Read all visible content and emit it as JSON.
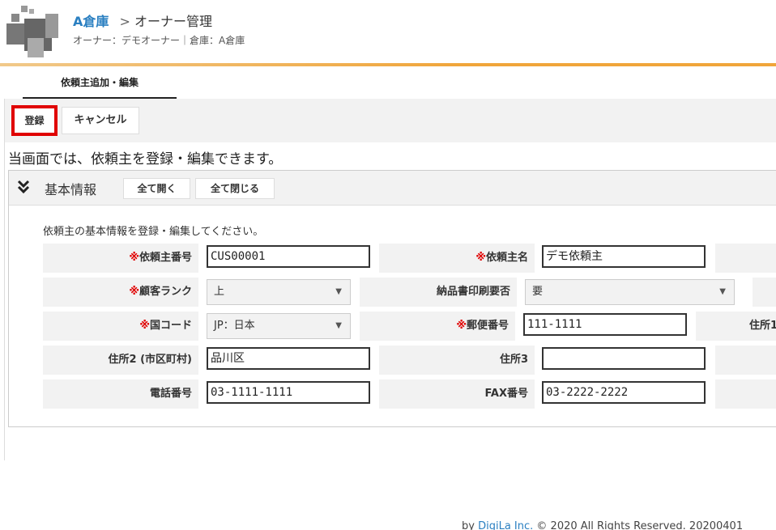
{
  "header": {
    "warehouse": "A倉庫",
    "crumb_sep": ">",
    "page": "オーナー管理",
    "subline": "オーナー：デモオーナー｜倉庫：A倉庫"
  },
  "tabs": [
    {
      "label": "依頼主追加・編集",
      "active": true
    }
  ],
  "toolbar": {
    "register_label": "登録",
    "cancel_label": "キャンセル"
  },
  "description": "当画面では、依頼主を登録・編集できます。",
  "section": {
    "title": "基本情報",
    "open_all_label": "全て開く",
    "close_all_label": "全て閉じる",
    "description": "依頼主の基本情報を登録・編集してください。"
  },
  "form": {
    "required_mark": "※",
    "client_code": {
      "label": "依頼主番号",
      "value": "CUS00001"
    },
    "client_name": {
      "label": "依頼主名",
      "value": "デモ依頼主"
    },
    "customer_rank": {
      "label": "顧客ランク",
      "value": "上"
    },
    "delivery_print": {
      "label": "納品書印刷要否",
      "value": "要"
    },
    "country_code": {
      "label": "国コード",
      "value": "JP：日本"
    },
    "postal_code": {
      "label": "郵便番号",
      "value": "111-1111"
    },
    "address1": {
      "label": "住所1"
    },
    "address2": {
      "label": "住所2 (市区町村)",
      "value": "品川区"
    },
    "address3": {
      "label": "住所3",
      "value": ""
    },
    "phone": {
      "label": "電話番号",
      "value": "03-1111-1111"
    },
    "fax": {
      "label": "FAX番号",
      "value": "03-2222-2222"
    }
  },
  "footer": {
    "prefix": "by",
    "brand": "DigiLa Inc.",
    "copyright": "© 2020 All Rights Reserved. 20200401"
  },
  "colors": {
    "accent": "#f0a53a",
    "link": "#2a7fc1",
    "required": "#e00000",
    "highlight": "#e00000"
  }
}
